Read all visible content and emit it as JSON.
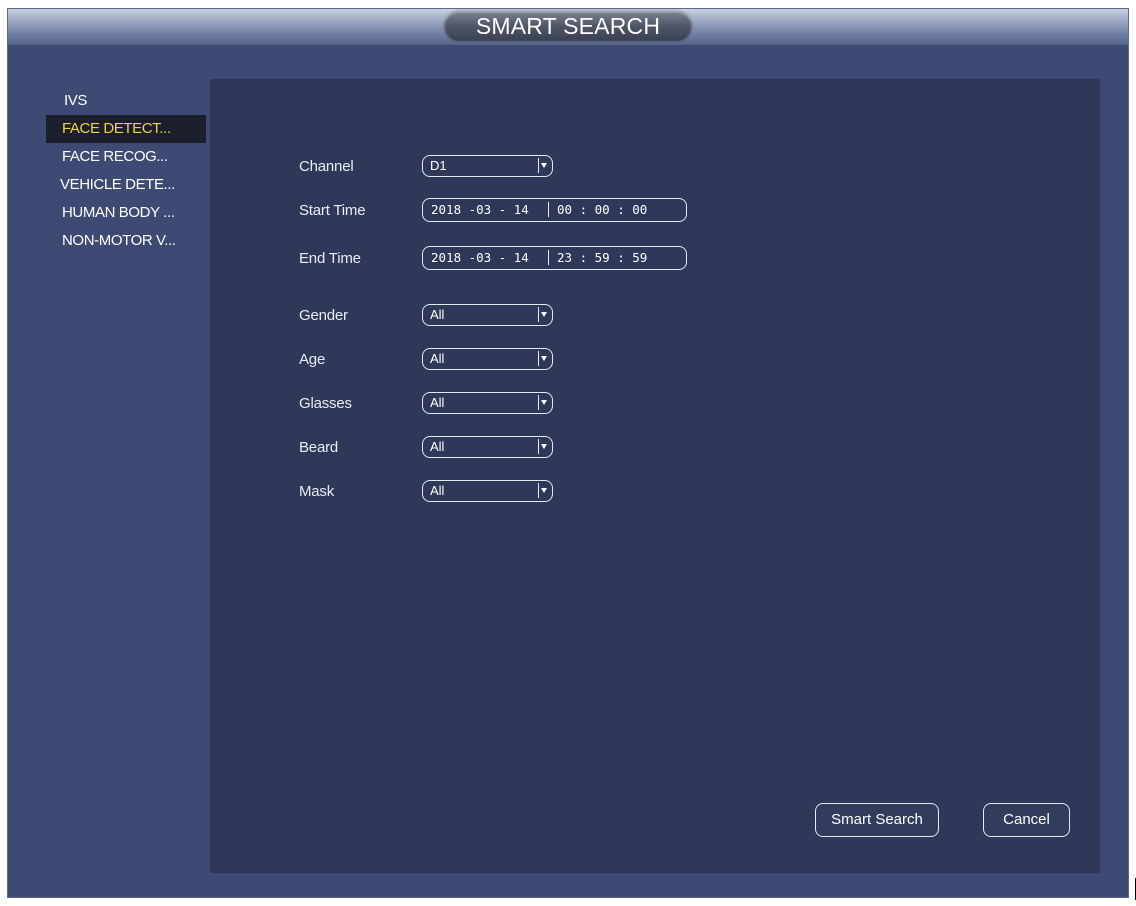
{
  "window": {
    "title": "SMART SEARCH"
  },
  "sidebar": {
    "items": [
      {
        "label": "IVS"
      },
      {
        "label": "FACE DETECT..."
      },
      {
        "label": "FACE RECOG..."
      },
      {
        "label": "VEHICLE DETE..."
      },
      {
        "label": "HUMAN BODY ..."
      },
      {
        "label": "NON-MOTOR V..."
      }
    ],
    "active_index": 1
  },
  "form": {
    "channel": {
      "label": "Channel",
      "value": "D1"
    },
    "start_time": {
      "label": "Start Time",
      "date": "2018 -03 - 14",
      "time": "00 : 00 : 00"
    },
    "end_time": {
      "label": "End Time",
      "date": "2018 -03 - 14",
      "time": "23 : 59 : 59"
    },
    "gender": {
      "label": "Gender",
      "value": "All"
    },
    "age": {
      "label": "Age",
      "value": "All"
    },
    "glasses": {
      "label": "Glasses",
      "value": "All"
    },
    "beard": {
      "label": "Beard",
      "value": "All"
    },
    "mask": {
      "label": "Mask",
      "value": "All"
    }
  },
  "buttons": {
    "smart_search": "Smart Search",
    "cancel": "Cancel"
  },
  "colors": {
    "window_bg": "#3d4a73",
    "panel_bg": "#2f3858",
    "active_item_text": "#f2d240",
    "active_item_bg": "#1b1f2b"
  }
}
